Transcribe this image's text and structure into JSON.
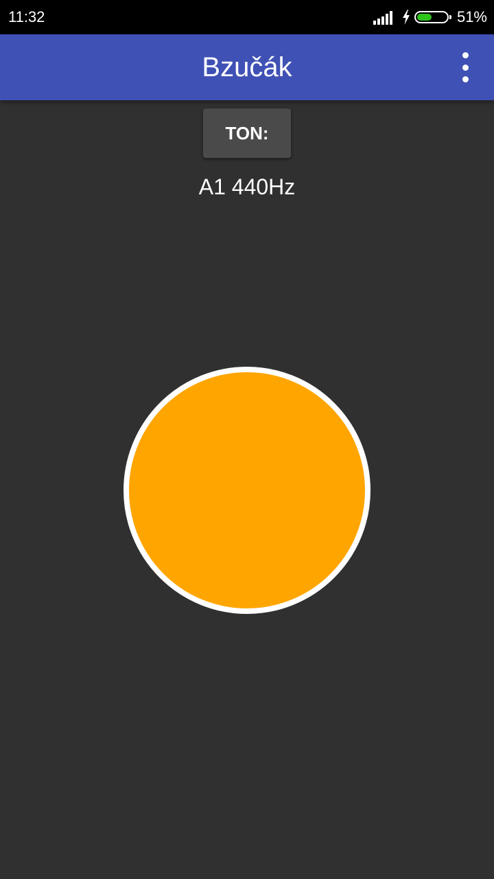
{
  "status_bar": {
    "time": "11:32",
    "battery_percent": "51%",
    "battery_level": 0.51,
    "battery_color": "#2ec31b",
    "signal_icon": "signal-icon",
    "charging_icon": "bolt-icon"
  },
  "app_bar": {
    "title": "Bzučák",
    "color": "#3f51b5",
    "menu_icon": "more-vert-icon"
  },
  "main": {
    "tone_button_label": "TON:",
    "tone_value": "A1 440Hz",
    "buzzer_color": "#ffa500",
    "buzzer_border_color": "#ffffff",
    "background_color": "#303030"
  }
}
